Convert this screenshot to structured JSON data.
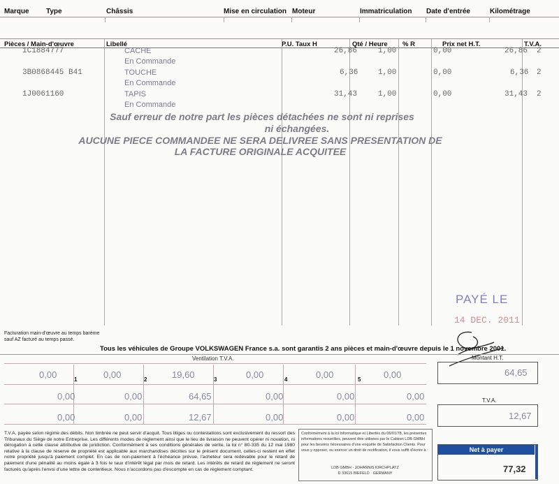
{
  "vehicle_header": {
    "marque": "Marque",
    "type": "Type",
    "chassis": "Châssis",
    "mise_en_circulation": "Mise en circulation",
    "moteur": "Moteur",
    "immatriculation": "Immatriculation",
    "date_entree": "Date d'entrée",
    "kilometrage": "Kilométrage"
  },
  "parts_header": {
    "pieces": "Pièces / Main-d'œuvre",
    "libelle": "Libellé",
    "pu": "P.U. Taux H",
    "qte": "Qté / Heure",
    "remise": "% R",
    "prix_net": "Prix net H.T.",
    "tva": "T.V.A."
  },
  "lines": [
    {
      "ref": "1C1884777",
      "libelle": "CACHE",
      "status": "En Commande",
      "pu": "26,86",
      "qte": "1,00",
      "remise": "0,00",
      "prix": "26,86",
      "tva": "2"
    },
    {
      "ref": "3B0868445  B41",
      "libelle": "TOUCHE",
      "status": "En Commande",
      "pu": "6,36",
      "qte": "1,00",
      "remise": "0,00",
      "prix": "6,36",
      "tva": "2"
    },
    {
      "ref": "1J0061160",
      "libelle": "TAPIS",
      "status": "En Commande",
      "pu": "31,43",
      "qte": "1,00",
      "remise": "0,00",
      "prix": "31,43",
      "tva": "2"
    }
  ],
  "notices": {
    "line1": "Sauf erreur de notre part les pièces détachées ne sont ni reprises",
    "line2": "ni échangées.",
    "line3": "AUCUNE PIECE COMMANDEE NE SERA DELIVREE SANS PRESENTATION DE",
    "line4": "LA FACTURE ORIGINALE ACQUITEE"
  },
  "stamp": {
    "paye": "PAYÉ LE",
    "date": "14 DEC. 2011"
  },
  "facturation_note": "Facturation main-d'œuvre au temps barème sauf AZ facturé au temps passé.",
  "guarantee": "Tous les véhicules de Groupe VOLKSWAGEN France s.a. sont garantis 2 ans pièces et main-d'œuvre depuis le 1 novembre 2001.",
  "ventilation": {
    "title": "Ventilation T.V.A.",
    "codes": [
      "1",
      "2",
      "3",
      "4",
      "5"
    ],
    "rates": [
      "0,00",
      "0,00",
      "19,60",
      "0,00",
      "0,00",
      "0,00"
    ],
    "bases": [
      "0,00",
      "0,00",
      "64,65",
      "0,00",
      "0,00",
      "0,00"
    ],
    "amounts": [
      "0,00",
      "0,00",
      "12,67",
      "0,00",
      "0,00",
      "0,00"
    ]
  },
  "totals": {
    "montant_ht_label": "Montant H.T.",
    "montant_ht": "64,65",
    "tva_label": "T.V.A.",
    "tva": "12,67",
    "net_label": "Net à payer",
    "net": "77,32"
  },
  "legal_text": "T.V.A. payée selon régime des débits. Non timbrée ne peut servir d'acquit. Tous litiges ou contestations sont exclusivement du ressort des Tribunaux du Siège de notre Entreprise. Les différents modes de règlement ainsi que le lieu de livraison ne peuvent opérer ni novation, ni dérogation à cette clause attributive de juridiction. Conformément à ses conditions générales de vente, la loi n° 80-335 du 12 mai 1980 relative à la clause de réserve de propriété est applicable aux marchandises décrites sur le présent document, celles-ci restent en effet notre propriété jusqu'à paiement complet. En cas de non-paiement à l'échéance prévue, l'acheteur sera redevable pour le retard de paiement d'une pénalité au moins égale à 3 fois le taux d'intérêt légal par mois de retard. Les intérêts de retard de règlement ne seront facturés qu'après l'envoi d'une lettre de contentieux. Nous n'accordons pas d'escompte en cas de règlement comptant.",
  "privacy_text": "Conformément à la loi Informatique et Libertés du 06/01/78, les présentes informations recueillies, peuvent être utilisées par le Cabinet LDB GMBH pour les besoins nécessaires d'une enquête de Satisfaction Clients. Pour vous y opposer, ou exercer un droit de rectification, il vous suffit d'écrire à :",
  "privacy_address": [
    "LDB GMBH · JOHANNIS KIRCHPLATZ",
    "D 33615 BIEFELD · GERMANY"
  ],
  "colors": {
    "stamp": "#7f7fbf",
    "stamp_date": "#d28a92",
    "net_bar": "#1f4f9f"
  }
}
